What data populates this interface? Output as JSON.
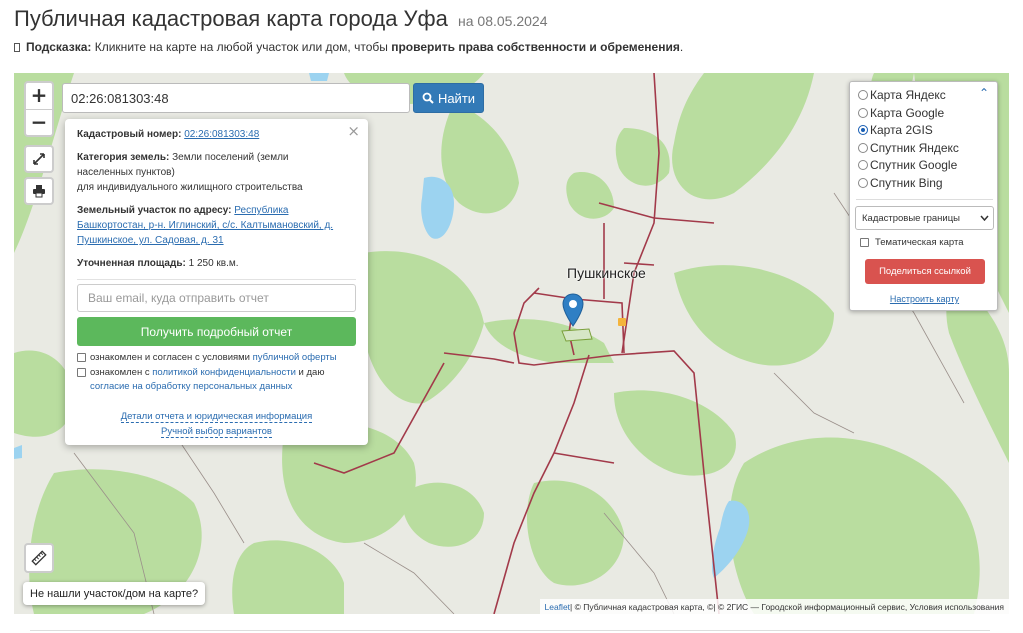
{
  "header": {
    "title": "Публичная кадастровая карта города Уфа",
    "date": "на 08.05.2024"
  },
  "hint": {
    "label": "Подсказка:",
    "text": " Кликните на карте на любой участок или дом, чтобы ",
    "emphasis": "проверить права собственности и обременения",
    "end": "."
  },
  "search": {
    "value": "02:26:081303:48",
    "button": "Найти"
  },
  "zoom": {
    "in": "+",
    "out": "−"
  },
  "popup": {
    "cad_label": "Кадастровый номер:",
    "cad_value": "02:26:081303:48",
    "category_label": "Категория земель:",
    "category_value": "Земли поселений (земли населенных пунктов)",
    "category_use": "для индивидуального жилищного строительства",
    "address_label": "Земельный участок по адресу:",
    "address_value": "Республика Башкортостан, р-н. Иглинский, с/с. Калтымановский, д. Пушкинское, ул. Садовая, д. 31",
    "area_label": "Уточненная площадь:",
    "area_value": "1 250 кв.м.",
    "email_placeholder": "Ваш email, куда отправить отчет",
    "report_button": "Получить подробный отчет",
    "agree1_text": "ознакомлен и согласен с условиями ",
    "agree1_link": "публичной оферты",
    "agree2_text": "ознакомлен с ",
    "agree2_link1": "политикой конфиденциальности",
    "agree2_mid": " и даю ",
    "agree2_link2": "согласие на обработку персональных данных",
    "link_details": "Детали отчета и юридическая информация",
    "link_manual": "Ручной выбор вариантов",
    "close": "×"
  },
  "layers": {
    "options": [
      {
        "label": "Карта Яндекс",
        "selected": false
      },
      {
        "label": "Карта Google",
        "selected": false
      },
      {
        "label": "Карта 2GIS",
        "selected": true
      },
      {
        "label": "Спутник Яндекс",
        "selected": false
      },
      {
        "label": "Спутник Google",
        "selected": false
      },
      {
        "label": "Спутник Bing",
        "selected": false
      }
    ],
    "select_value": "Кадастровые границы",
    "thematic_label": "Тематическая карта",
    "share_button": "Поделиться ссылкой",
    "setup_link": "Настроить карту"
  },
  "map": {
    "town_label": "Пушкинское",
    "not_found": "Не нашли участок/дом на карте?",
    "attribution_leaflet": "Leaflet",
    "attribution_text": " | © Публичная кадастровая карта, ©| © 2ГИС — Городской информационный сервис, Условия использования",
    "colors": {
      "forest": "#b9dd9f",
      "field": "#e9eae3",
      "water": "#9cd3f0",
      "road": "#a23a4a",
      "pin": "#2f7fc4"
    }
  }
}
